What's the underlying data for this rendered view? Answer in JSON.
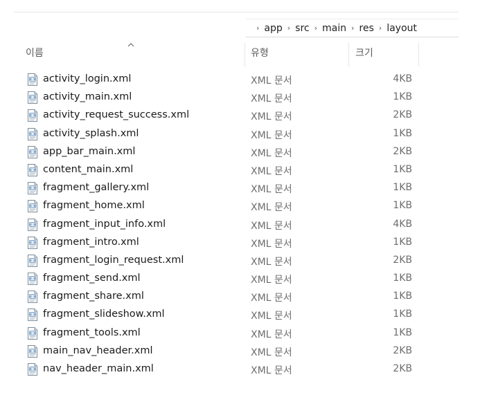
{
  "breadcrumb": [
    "app",
    "src",
    "main",
    "res",
    "layout"
  ],
  "columns": {
    "name": "이름",
    "type": "유형",
    "size": "크기"
  },
  "files": [
    {
      "name": "activity_login.xml",
      "type": "XML 문서",
      "size": "4KB"
    },
    {
      "name": "activity_main.xml",
      "type": "XML 문서",
      "size": "1KB"
    },
    {
      "name": "activity_request_success.xml",
      "type": "XML 문서",
      "size": "2KB"
    },
    {
      "name": "activity_splash.xml",
      "type": "XML 문서",
      "size": "1KB"
    },
    {
      "name": "app_bar_main.xml",
      "type": "XML 문서",
      "size": "2KB"
    },
    {
      "name": "content_main.xml",
      "type": "XML 문서",
      "size": "1KB"
    },
    {
      "name": "fragment_gallery.xml",
      "type": "XML 문서",
      "size": "1KB"
    },
    {
      "name": "fragment_home.xml",
      "type": "XML 문서",
      "size": "1KB"
    },
    {
      "name": "fragment_input_info.xml",
      "type": "XML 문서",
      "size": "4KB"
    },
    {
      "name": "fragment_intro.xml",
      "type": "XML 문서",
      "size": "1KB"
    },
    {
      "name": "fragment_login_request.xml",
      "type": "XML 문서",
      "size": "2KB"
    },
    {
      "name": "fragment_send.xml",
      "type": "XML 문서",
      "size": "1KB"
    },
    {
      "name": "fragment_share.xml",
      "type": "XML 문서",
      "size": "1KB"
    },
    {
      "name": "fragment_slideshow.xml",
      "type": "XML 문서",
      "size": "1KB"
    },
    {
      "name": "fragment_tools.xml",
      "type": "XML 문서",
      "size": "1KB"
    },
    {
      "name": "main_nav_header.xml",
      "type": "XML 문서",
      "size": "2KB"
    },
    {
      "name": "nav_header_main.xml",
      "type": "XML 문서",
      "size": "2KB"
    }
  ],
  "icons": {
    "file": "xml-file-icon",
    "sort": "sort-ascending-caret-icon",
    "separator": "chevron-right-icon"
  }
}
